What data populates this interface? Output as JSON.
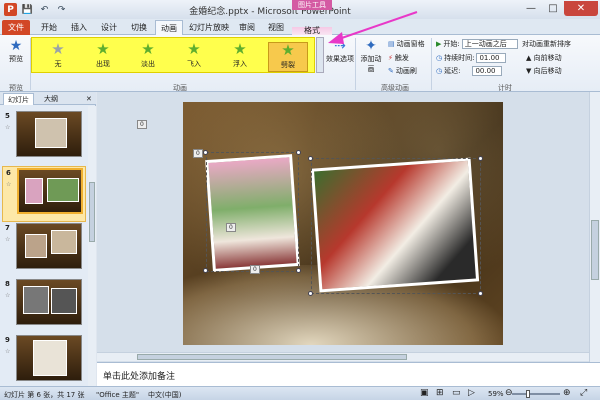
{
  "window": {
    "title": "金婚纪念.pptx - Microsoft PowerPoint",
    "context_tools_label": "图片工具",
    "minimize": "—",
    "maximize": "□",
    "close": "✕"
  },
  "qat": {
    "save": "💾",
    "undo": "↶",
    "redo": "↷"
  },
  "tabs": [
    {
      "label": "文件"
    },
    {
      "label": "开始"
    },
    {
      "label": "插入"
    },
    {
      "label": "设计"
    },
    {
      "label": "切换"
    },
    {
      "label": "动画"
    },
    {
      "label": "幻灯片放映"
    },
    {
      "label": "审阅"
    },
    {
      "label": "视图"
    },
    {
      "label": "格式"
    }
  ],
  "ribbon": {
    "preview": {
      "label": "预览",
      "group": "预览"
    },
    "animation_group": "动画",
    "effects": [
      {
        "label": "无"
      },
      {
        "label": "出现"
      },
      {
        "label": "淡出"
      },
      {
        "label": "飞入"
      },
      {
        "label": "浮入"
      },
      {
        "label": "劈裂"
      }
    ],
    "effect_options": "效果选项",
    "add_animation": "添加动画",
    "advanced_group": "高级动画",
    "animation_pane": "动画窗格",
    "trigger": "触发",
    "animation_painter": "动画刷",
    "start_label": "开始:",
    "start_value": "上一动画之后",
    "duration_label": "持续时间:",
    "duration_value": "01.00",
    "delay_label": "延迟:",
    "delay_value": "00.00",
    "timing_group": "计时",
    "reorder_label": "对动画重新排序",
    "move_earlier": "▲ 向前移动",
    "move_later": "▼ 向后移动"
  },
  "panel": {
    "tab_slides": "幻灯片",
    "tab_outline": "大纲",
    "close": "✕",
    "thumbs": [
      {
        "num": "5"
      },
      {
        "num": "6"
      },
      {
        "num": "7"
      },
      {
        "num": "8"
      },
      {
        "num": "9"
      }
    ]
  },
  "slide_tags": [
    "0",
    "0",
    "0",
    "0",
    "0"
  ],
  "notes_placeholder": "单击此处添加备注",
  "status": {
    "slide_info": "幻灯片 第 6 张，共 17 张",
    "theme": "\"Office 主题\"",
    "language": "中文(中国)",
    "zoom": "59%"
  },
  "colors": {
    "file_tab": "#d24726",
    "gallery_highlight": "#ffff4d",
    "selected_effect": "#f7c94c",
    "annotation_arrow": "#e838c8",
    "context_tab": "#d45aa3"
  }
}
